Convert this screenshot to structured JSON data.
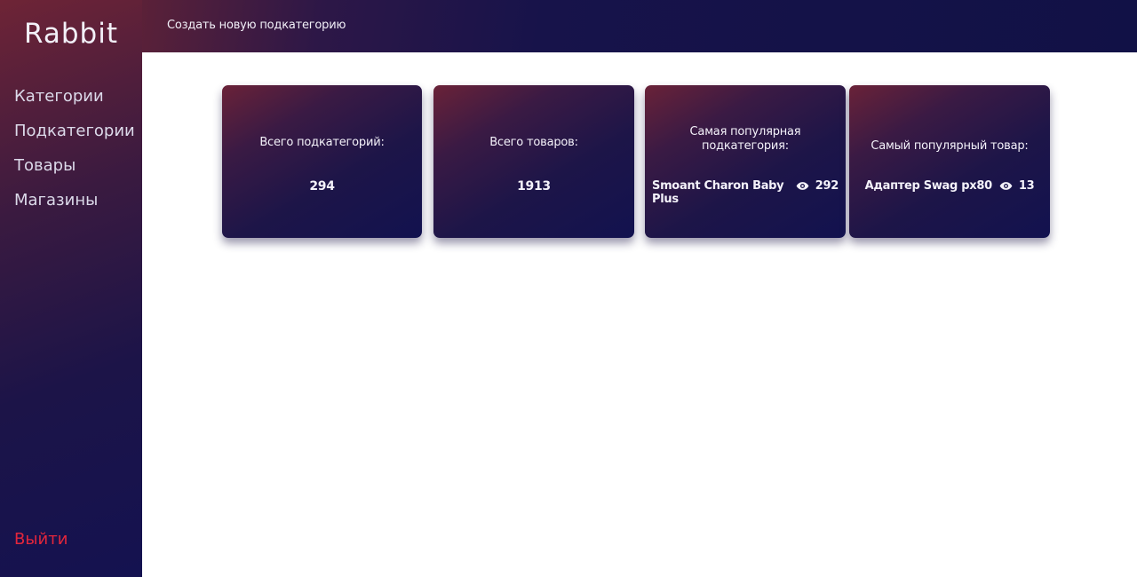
{
  "sidebar": {
    "logo": "Rabbit",
    "items": [
      {
        "label": "Категории"
      },
      {
        "label": "Подкатегории"
      },
      {
        "label": "Товары"
      },
      {
        "label": "Магазины"
      }
    ],
    "logout": "Выйти"
  },
  "header": {
    "action": "Создать новую подкатегорию"
  },
  "stats": {
    "subcategories": {
      "title": "Всего подкатегорий:",
      "value": "294"
    },
    "products": {
      "title": "Всего товаров:",
      "value": "1913"
    },
    "popular_subcategory": {
      "title_line1": "Самая популярная",
      "title_line2": "подкатегория:",
      "name_line1": "Smoant Charon Baby",
      "name_line2": "Plus",
      "views": "292",
      "icon": "eye-icon"
    },
    "popular_product": {
      "title": "Самый популярный товар:",
      "name": "Адаптер Swag px80",
      "views": "13",
      "icon": "eye-icon"
    }
  },
  "colors": {
    "accent_dark": "#141250",
    "accent_red": "#6e2436",
    "logout": "#e3263c"
  }
}
